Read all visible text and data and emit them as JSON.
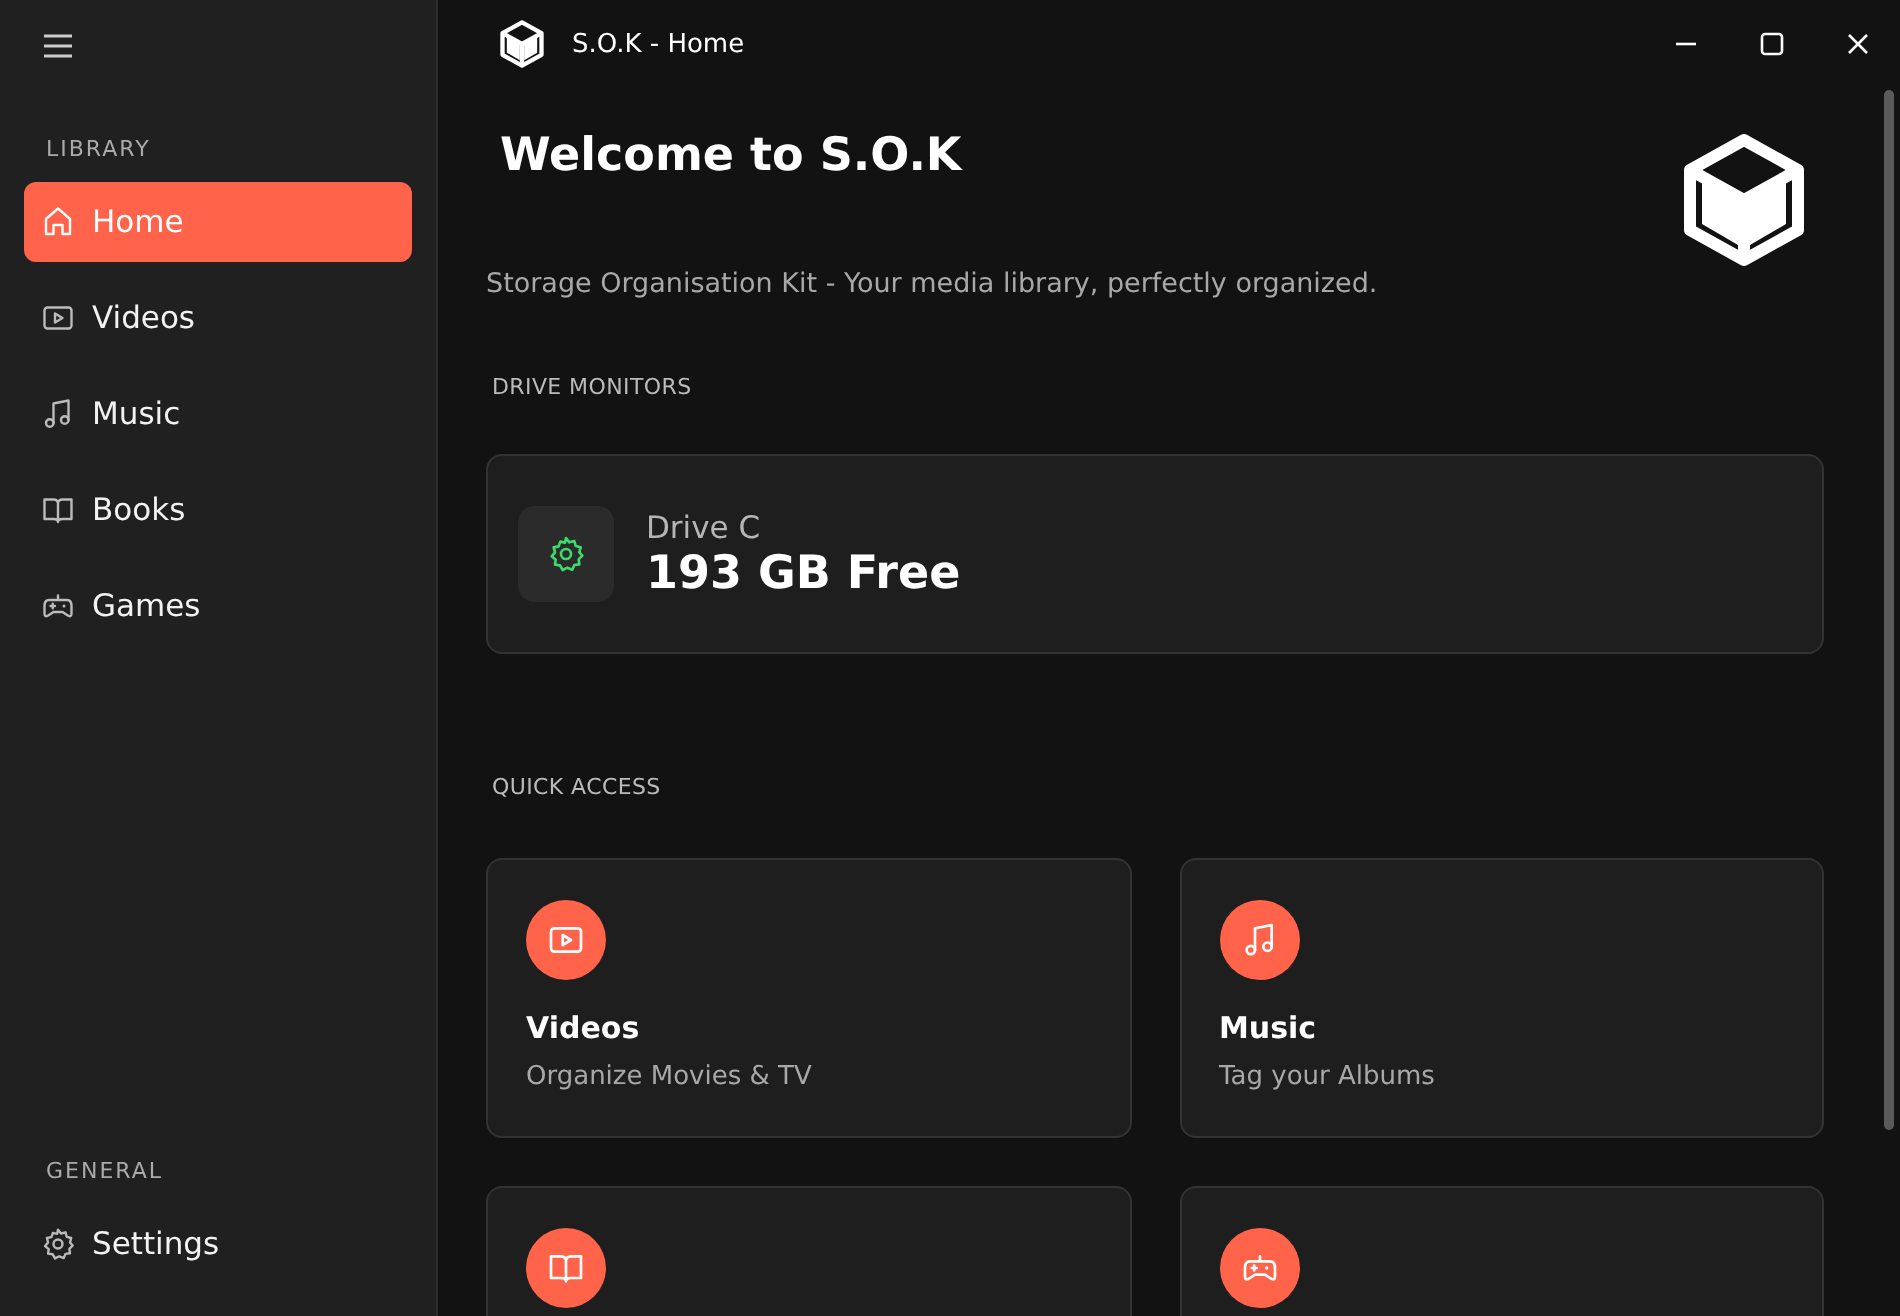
{
  "window": {
    "title": "S.O.K - Home"
  },
  "sidebar": {
    "sections": [
      {
        "heading": "LIBRARY",
        "items": [
          {
            "label": "Home",
            "kind": "home",
            "selected": true
          },
          {
            "label": "Videos",
            "kind": "video",
            "selected": false
          },
          {
            "label": "Music",
            "kind": "music",
            "selected": false
          },
          {
            "label": "Books",
            "kind": "book",
            "selected": false
          },
          {
            "label": "Games",
            "kind": "game",
            "selected": false
          }
        ]
      },
      {
        "heading": "GENERAL",
        "items": [
          {
            "label": "Settings",
            "kind": "settings",
            "selected": false
          }
        ]
      }
    ]
  },
  "main": {
    "title": "Welcome to S.O.K",
    "subtitle": "Storage Organisation Kit - Your media library, perfectly organized.",
    "drive_monitors": {
      "heading": "DRIVE MONITORS",
      "drives": [
        {
          "name": "Drive C",
          "free": "193 GB Free"
        }
      ]
    },
    "quick_access": {
      "heading": "QUICK ACCESS",
      "cards": [
        {
          "kind": "video",
          "title": "Videos",
          "subtitle": "Organize Movies & TV"
        },
        {
          "kind": "music",
          "title": "Music",
          "subtitle": "Tag your Albums"
        },
        {
          "kind": "book"
        },
        {
          "kind": "game"
        }
      ]
    }
  }
}
